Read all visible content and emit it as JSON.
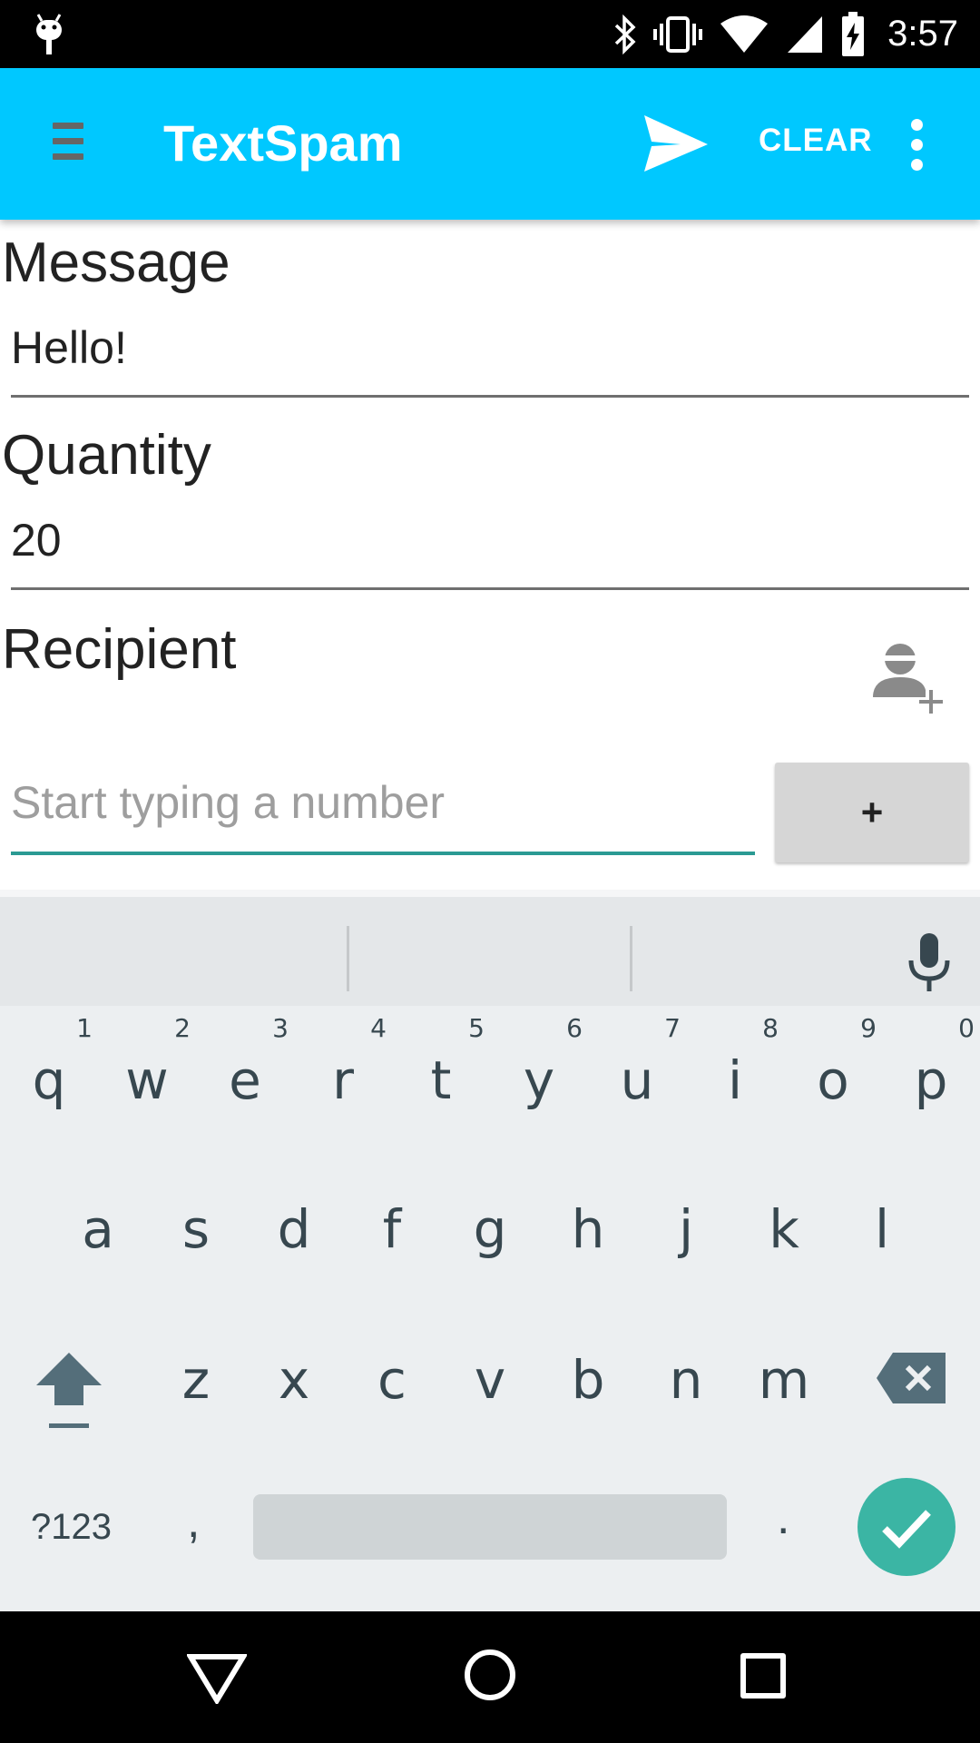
{
  "status_bar": {
    "time": "3:57",
    "icons": [
      "android-debug-icon",
      "bluetooth-icon",
      "vibrate-icon",
      "wifi-icon",
      "signal-icon",
      "battery-charging-icon"
    ]
  },
  "toolbar": {
    "title": "TextSpam",
    "clear_label": "CLEAR",
    "background_color": "#00c8ff"
  },
  "form": {
    "message": {
      "label": "Message",
      "value": "Hello!"
    },
    "quantity": {
      "label": "Quantity",
      "value": "20"
    },
    "recipient": {
      "label": "Recipient",
      "placeholder": "Start typing a number",
      "add_button_label": "+"
    }
  },
  "keyboard": {
    "row1": [
      {
        "ch": "q",
        "hint": "1"
      },
      {
        "ch": "w",
        "hint": "2"
      },
      {
        "ch": "e",
        "hint": "3"
      },
      {
        "ch": "r",
        "hint": "4"
      },
      {
        "ch": "t",
        "hint": "5"
      },
      {
        "ch": "y",
        "hint": "6"
      },
      {
        "ch": "u",
        "hint": "7"
      },
      {
        "ch": "i",
        "hint": "8"
      },
      {
        "ch": "o",
        "hint": "9"
      },
      {
        "ch": "p",
        "hint": "0"
      }
    ],
    "row2": [
      "a",
      "s",
      "d",
      "f",
      "g",
      "h",
      "j",
      "k",
      "l"
    ],
    "row3": [
      "z",
      "x",
      "c",
      "v",
      "b",
      "n",
      "m"
    ],
    "symbols_label": "?123",
    "comma": ",",
    "period": ".",
    "done_color": "#3bb5a4"
  }
}
